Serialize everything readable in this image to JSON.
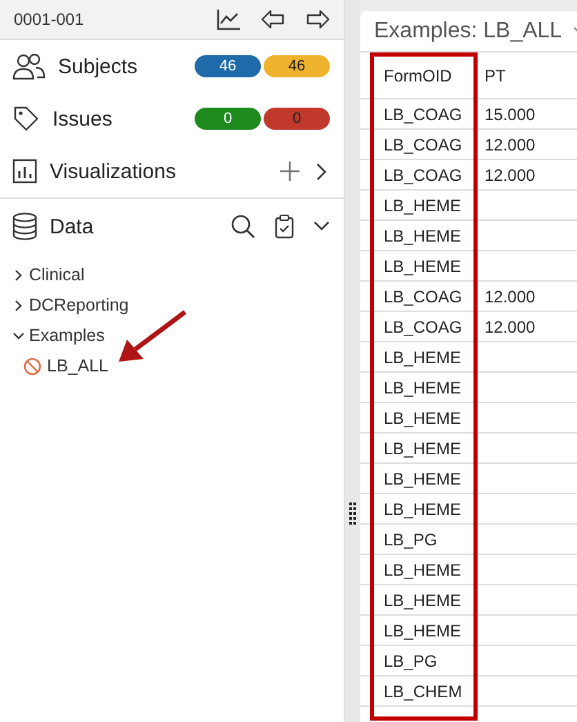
{
  "header": {
    "subject_id": "0001-001"
  },
  "nav": [
    {
      "kind": "subjects",
      "label": "Subjects",
      "badges": [
        {
          "text": "46",
          "color": "#1f6aa8"
        },
        {
          "text": "46",
          "color": "#f0b32e"
        }
      ]
    },
    {
      "kind": "issues",
      "label": "Issues",
      "badges": [
        {
          "text": "0",
          "color": "#1e8a1e"
        },
        {
          "text": "0",
          "color": "#c0392b"
        }
      ]
    },
    {
      "kind": "visualizations",
      "label": "Visualizations"
    }
  ],
  "data": {
    "label": "Data",
    "tree": [
      {
        "label": "Clinical",
        "expanded": false
      },
      {
        "label": "DCReporting",
        "expanded": false
      },
      {
        "label": "Examples",
        "expanded": true,
        "children": [
          {
            "label": "LB_ALL"
          }
        ]
      }
    ]
  },
  "view": {
    "title": "Examples: LB_ALL",
    "columns": [
      "FormOID",
      "PT"
    ],
    "rows": [
      [
        "LB_COAG",
        "15.000"
      ],
      [
        "LB_COAG",
        "12.000"
      ],
      [
        "LB_COAG",
        "12.000"
      ],
      [
        "LB_HEME"
      ],
      [
        "LB_HEME"
      ],
      [
        "LB_HEME"
      ],
      [
        "LB_COAG",
        "12.000"
      ],
      [
        "LB_COAG",
        "12.000"
      ],
      [
        "LB_HEME"
      ],
      [
        "LB_HEME"
      ],
      [
        "LB_HEME"
      ],
      [
        "LB_HEME"
      ],
      [
        "LB_HEME"
      ],
      [
        "LB_HEME"
      ],
      [
        "LB_PG"
      ],
      [
        "LB_HEME"
      ],
      [
        "LB_HEME"
      ],
      [
        "LB_HEME"
      ],
      [
        "LB_PG"
      ],
      [
        "LB_CHEM"
      ]
    ]
  }
}
